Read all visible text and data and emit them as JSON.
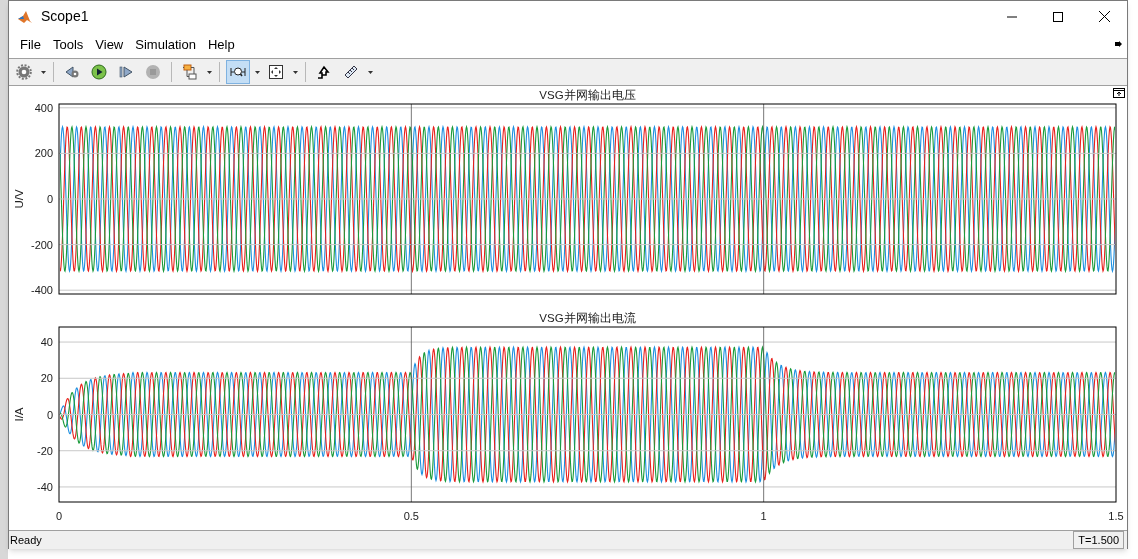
{
  "window": {
    "title": "Scope1"
  },
  "menu": [
    {
      "label": "File"
    },
    {
      "label": "Tools"
    },
    {
      "label": "View"
    },
    {
      "label": "Simulation"
    },
    {
      "label": "Help"
    }
  ],
  "toolbar": [
    {
      "kind": "gear",
      "dropdown": true,
      "selected": false
    },
    {
      "kind": "sep"
    },
    {
      "kind": "step-back",
      "dropdown": false,
      "selected": false
    },
    {
      "kind": "run",
      "dropdown": false,
      "selected": false
    },
    {
      "kind": "step-forward",
      "dropdown": false,
      "selected": false
    },
    {
      "kind": "stop",
      "dropdown": false,
      "selected": false,
      "disabled": true
    },
    {
      "kind": "sep"
    },
    {
      "kind": "blocks",
      "dropdown": true,
      "selected": false
    },
    {
      "kind": "sep"
    },
    {
      "kind": "zoom-x",
      "dropdown": true,
      "selected": true
    },
    {
      "kind": "fit",
      "dropdown": true,
      "selected": false
    },
    {
      "kind": "sep"
    },
    {
      "kind": "style",
      "dropdown": false,
      "selected": false
    },
    {
      "kind": "ruler",
      "dropdown": true,
      "selected": false
    }
  ],
  "plots": [
    {
      "kind": "voltage",
      "title": "VSG并网输出电压",
      "ylabel": "U/V",
      "yticks": [
        "400",
        "200",
        "0",
        "-200",
        "-400"
      ],
      "grid": true
    },
    {
      "kind": "current",
      "title": "VSG并网输出电流",
      "ylabel": "I/A",
      "yticks": [
        "40",
        "20",
        "0",
        "-20",
        "-40"
      ],
      "xticks": [
        "0",
        "0.5",
        "1",
        "1.5"
      ],
      "grid": true
    }
  ],
  "status_bar": {
    "text": "Ready",
    "time": "T=1.500"
  }
}
